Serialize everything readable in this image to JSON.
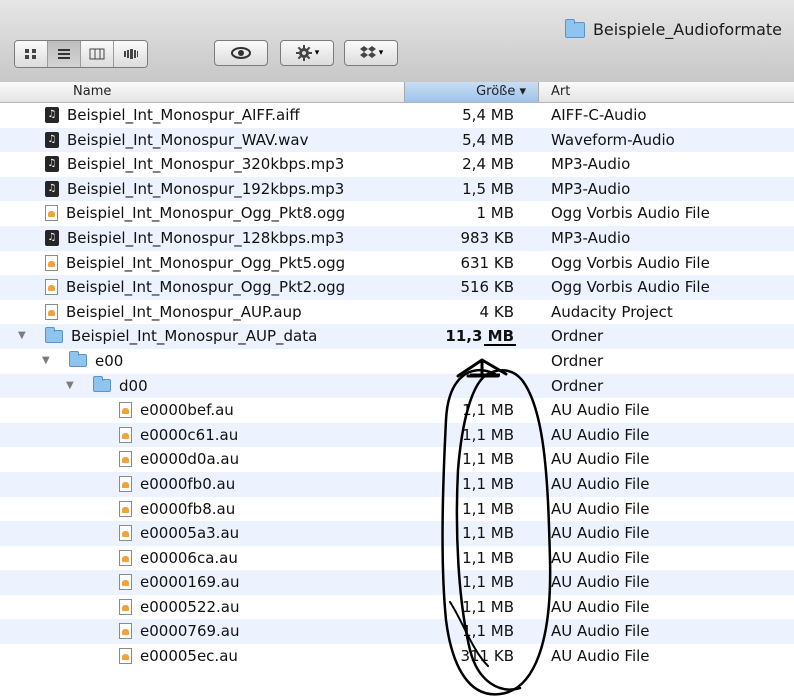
{
  "window": {
    "title": "Beispiele_Audioformate"
  },
  "toolbar": {
    "view_buttons": [
      "icon-view-icon",
      "list-view-icon",
      "column-view-icon",
      "coverflow-view-icon"
    ],
    "quicklook": "eye-icon",
    "action": "gear-icon",
    "dropbox": "dropbox-icon"
  },
  "columns": {
    "name": "Name",
    "size": "Größe ▾",
    "type": "Art"
  },
  "rows": [
    {
      "name": "Beispiel_Int_Monospur_AIFF.aiff",
      "size": "5,4 MB",
      "type": "AIFF-C-Audio",
      "icon": "audio"
    },
    {
      "name": "Beispiel_Int_Monospur_WAV.wav",
      "size": "5,4 MB",
      "type": "Waveform-Audio",
      "icon": "audio"
    },
    {
      "name": "Beispiel_Int_Monospur_320kbps.mp3",
      "size": "2,4 MB",
      "type": "MP3-Audio",
      "icon": "audio"
    },
    {
      "name": "Beispiel_Int_Monospur_192kbps.mp3",
      "size": "1,5 MB",
      "type": "MP3-Audio",
      "icon": "audio"
    },
    {
      "name": "Beispiel_Int_Monospur_Ogg_Pkt8.ogg",
      "size": "1 MB",
      "type": "Ogg Vorbis Audio File",
      "icon": "doc"
    },
    {
      "name": "Beispiel_Int_Monospur_128kbps.mp3",
      "size": "983 KB",
      "type": "MP3-Audio",
      "icon": "audio"
    },
    {
      "name": "Beispiel_Int_Monospur_Ogg_Pkt5.ogg",
      "size": "631 KB",
      "type": "Ogg Vorbis Audio File",
      "icon": "doc"
    },
    {
      "name": "Beispiel_Int_Monospur_Ogg_Pkt2.ogg",
      "size": "516 KB",
      "type": "Ogg Vorbis Audio File",
      "icon": "doc"
    },
    {
      "name": "Beispiel_Int_Monospur_AUP.aup",
      "size": "4 KB",
      "type": "Audacity Project",
      "icon": "doc"
    },
    {
      "name": "Beispiel_Int_Monospur_AUP_data",
      "size": "11,3 MB",
      "type": "Ordner",
      "icon": "folder"
    },
    {
      "name": "e00",
      "size": "",
      "type": "Ordner",
      "icon": "folder"
    },
    {
      "name": "d00",
      "size": "",
      "type": "Ordner",
      "icon": "folder"
    },
    {
      "name": "e0000bef.au",
      "size": "1,1 MB",
      "type": "AU Audio File",
      "icon": "doc"
    },
    {
      "name": "e0000c61.au",
      "size": "1,1 MB",
      "type": "AU Audio File",
      "icon": "doc"
    },
    {
      "name": "e0000d0a.au",
      "size": "1,1 MB",
      "type": "AU Audio File",
      "icon": "doc"
    },
    {
      "name": "e0000fb0.au",
      "size": "1,1 MB",
      "type": "AU Audio File",
      "icon": "doc"
    },
    {
      "name": "e0000fb8.au",
      "size": "1,1 MB",
      "type": "AU Audio File",
      "icon": "doc"
    },
    {
      "name": "e00005a3.au",
      "size": "1,1 MB",
      "type": "AU Audio File",
      "icon": "doc"
    },
    {
      "name": "e00006ca.au",
      "size": "1,1 MB",
      "type": "AU Audio File",
      "icon": "doc"
    },
    {
      "name": "e0000169.au",
      "size": "1,1 MB",
      "type": "AU Audio File",
      "icon": "doc"
    },
    {
      "name": "e0000522.au",
      "size": "1,1 MB",
      "type": "AU Audio File",
      "icon": "doc"
    },
    {
      "name": "e0000769.au",
      "size": "1,1 MB",
      "type": "AU Audio File",
      "icon": "doc"
    },
    {
      "name": "e00005ec.au",
      "size": "311 KB",
      "type": "AU Audio File",
      "icon": "doc"
    }
  ],
  "colors": {
    "row_alt": "#edf3fe",
    "header_sort": "#b7d2f0",
    "annotation": "#000000"
  }
}
